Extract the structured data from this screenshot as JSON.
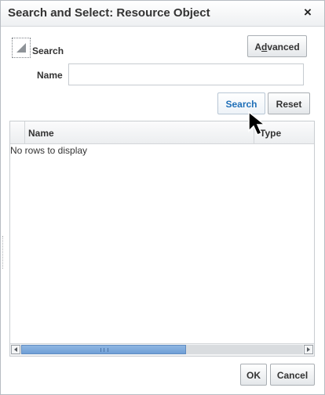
{
  "dialog": {
    "title": "Search and Select: Resource Object",
    "close_label": "×"
  },
  "search": {
    "section_label": "Search",
    "advanced_label_prefix": "A",
    "advanced_label_underlined": "d",
    "advanced_label_suffix": "vanced",
    "name_label": "Name",
    "name_value": "",
    "search_button": "Search",
    "reset_button": "Reset"
  },
  "table": {
    "columns": [
      "Name",
      "Type"
    ],
    "empty_message": "No rows to display"
  },
  "footer": {
    "ok_button": "OK",
    "cancel_button": "Cancel"
  },
  "icons": {
    "disclosure": "disclosure-triangle-icon",
    "scroll_left": "scroll-left-arrow-icon",
    "scroll_right": "scroll-right-arrow-icon",
    "cursor": "mouse-pointer-icon"
  },
  "colors": {
    "search_button_text": "#1f6fb8",
    "scroll_thumb": "#7aa8dc"
  }
}
